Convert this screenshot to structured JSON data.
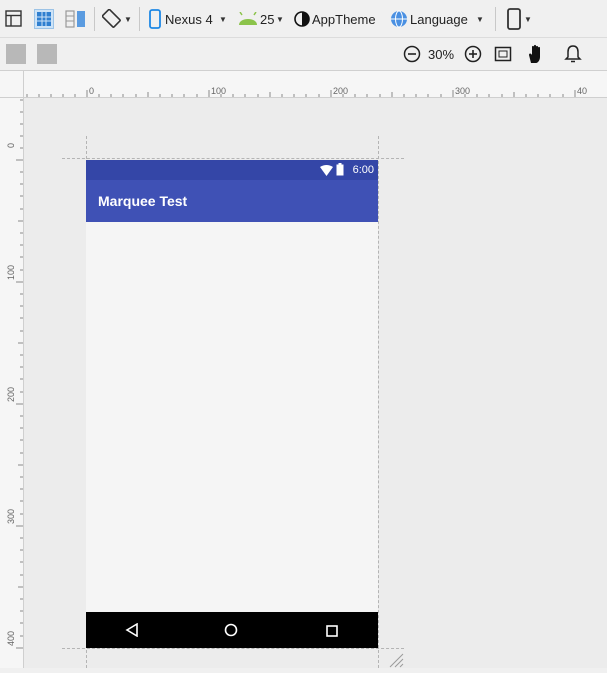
{
  "toolbar": {
    "device": "Nexus 4",
    "api_level": "25",
    "theme": "AppTheme",
    "language": "Language",
    "zoom": "30%"
  },
  "ruler": {
    "top_ticks": [
      "0",
      "100",
      "200",
      "300",
      "40"
    ],
    "left_ticks": [
      "0",
      "100",
      "200",
      "300",
      "400"
    ]
  },
  "phone": {
    "status_time": "6:00",
    "app_title": "Marquee Test"
  }
}
